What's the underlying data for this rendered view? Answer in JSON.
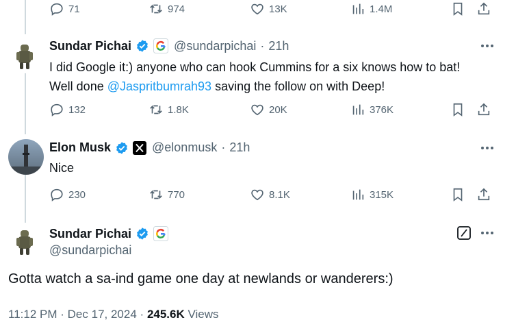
{
  "top_actions": {
    "replies": "71",
    "reposts": "974",
    "likes": "13K",
    "views": "1.4M"
  },
  "tweets": [
    {
      "name": "Sundar Pichai",
      "handle": "@sundarpichai",
      "separator": "·",
      "time": "21h",
      "text_parts": {
        "line1": "I did Google it:) anyone who can hook Cummins for a six knows how to bat!",
        "line2_pre": "Well done ",
        "mention": "@Jaspritbumrah93",
        "line2_post": " saving the follow on with Deep!"
      },
      "replies": "132",
      "reposts": "1.8K",
      "likes": "20K",
      "views": "376K"
    },
    {
      "name": "Elon Musk",
      "handle": "@elonmusk",
      "separator": "·",
      "time": "21h",
      "text": "Nice",
      "replies": "230",
      "reposts": "770",
      "likes": "8.1K",
      "views": "315K"
    }
  ],
  "focus": {
    "name": "Sundar Pichai",
    "handle": "@sundarpichai",
    "text": "Gotta watch a sa-ind game one day at newlands or wanderers:)",
    "time": "11:12 PM",
    "dot1": "·",
    "date": "Dec 17, 2024",
    "dot2": "·",
    "views_count": "245.6K",
    "views_label": "Views"
  },
  "icons": {
    "verified": "verified-badge-icon",
    "google": "google-logo-icon",
    "x": "x-logo-icon"
  },
  "colors": {
    "accent": "#1d9bf0",
    "muted": "#536471",
    "text": "#0f1419",
    "line": "#cfd9de"
  }
}
